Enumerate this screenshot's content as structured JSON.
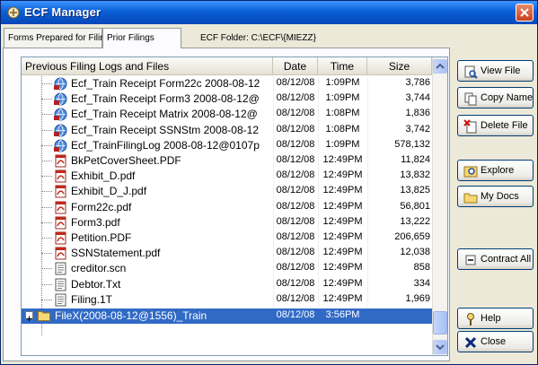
{
  "window": {
    "title": "ECF Manager"
  },
  "tabs": [
    {
      "label": "Forms Prepared for Filing",
      "active": false
    },
    {
      "label": "Prior Filings",
      "active": true
    }
  ],
  "folder": {
    "label": "ECF Folder:  C:\\ECF\\{MIEZZ}"
  },
  "list": {
    "headers": {
      "name": "Previous Filing Logs and Files",
      "date": "Date",
      "time": "Time",
      "size": "Size"
    },
    "rows": [
      {
        "name": "Ecf_Train Receipt Form22c 2008-08-12",
        "date": "08/12/08",
        "time": "1:09PM",
        "size": "3,786",
        "icon": "web-receipt-icon"
      },
      {
        "name": "Ecf_Train Receipt Form3 2008-08-12@",
        "date": "08/12/08",
        "time": "1:09PM",
        "size": "3,744",
        "icon": "web-receipt-icon"
      },
      {
        "name": "Ecf_Train Receipt Matrix 2008-08-12@",
        "date": "08/12/08",
        "time": "1:08PM",
        "size": "1,836",
        "icon": "web-receipt-icon"
      },
      {
        "name": "Ecf_Train Receipt SSNStm 2008-08-12",
        "date": "08/12/08",
        "time": "1:08PM",
        "size": "3,742",
        "icon": "web-receipt-icon"
      },
      {
        "name": "Ecf_TrainFilingLog 2008-08-12@0107p",
        "date": "08/12/08",
        "time": "1:09PM",
        "size": "578,132",
        "icon": "web-receipt-icon"
      },
      {
        "name": "BkPetCoverSheet.PDF",
        "date": "08/12/08",
        "time": "12:49PM",
        "size": "11,824",
        "icon": "pdf-icon"
      },
      {
        "name": "Exhibit_D.pdf",
        "date": "08/12/08",
        "time": "12:49PM",
        "size": "13,832",
        "icon": "pdf-icon"
      },
      {
        "name": "Exhibit_D_J.pdf",
        "date": "08/12/08",
        "time": "12:49PM",
        "size": "13,825",
        "icon": "pdf-icon"
      },
      {
        "name": "Form22c.pdf",
        "date": "08/12/08",
        "time": "12:49PM",
        "size": "56,801",
        "icon": "pdf-icon"
      },
      {
        "name": "Form3.pdf",
        "date": "08/12/08",
        "time": "12:49PM",
        "size": "13,222",
        "icon": "pdf-icon"
      },
      {
        "name": "Petition.PDF",
        "date": "08/12/08",
        "time": "12:49PM",
        "size": "206,659",
        "icon": "pdf-icon"
      },
      {
        "name": "SSNStatement.pdf",
        "date": "08/12/08",
        "time": "12:49PM",
        "size": "12,038",
        "icon": "pdf-icon"
      },
      {
        "name": "creditor.scn",
        "date": "08/12/08",
        "time": "12:49PM",
        "size": "858",
        "icon": "text-file-icon"
      },
      {
        "name": "Debtor.Txt",
        "date": "08/12/08",
        "time": "12:49PM",
        "size": "334",
        "icon": "text-file-icon"
      },
      {
        "name": "Filing.1T",
        "date": "08/12/08",
        "time": "12:49PM",
        "size": "1,969",
        "icon": "text-file-icon"
      }
    ],
    "selected_folder": {
      "name": "FileX(2008-08-12@1556)_Train",
      "date": "08/12/08",
      "time": "3:56PM",
      "size": ""
    }
  },
  "buttons": {
    "view_file": "View File",
    "copy_name": "Copy Name",
    "delete_file": "Delete File",
    "explore": "Explore",
    "my_docs": "My Docs",
    "contract_all": "Contract All",
    "help": "Help",
    "close": "Close"
  },
  "colors": {
    "selection": "#316AC5",
    "titlebar": "#0A5FD8",
    "close_button": "#C6401E"
  }
}
